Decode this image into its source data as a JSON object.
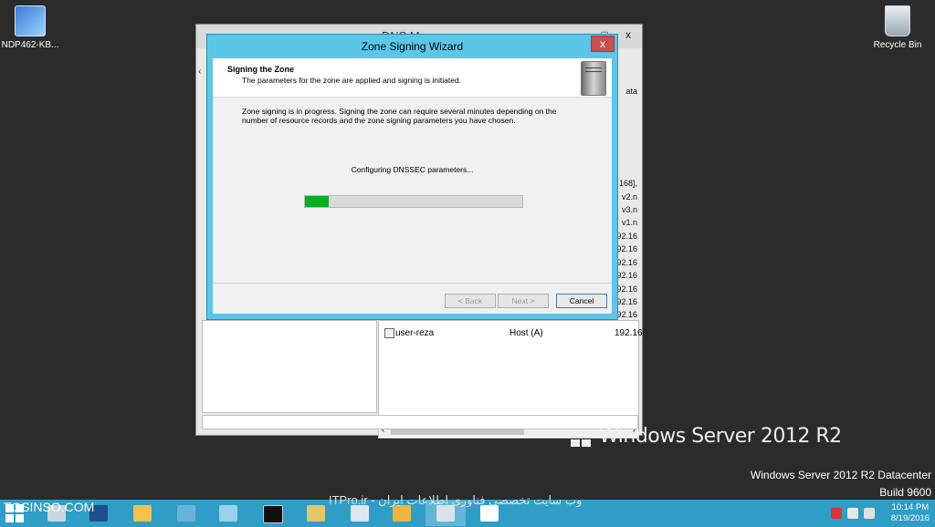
{
  "desktop": {
    "icons": [
      {
        "label": "NDP462-KB..."
      },
      {
        "label": "Recycle Bin"
      }
    ]
  },
  "dns_manager": {
    "title": "DNS Manager",
    "controls": {
      "minimize": "–",
      "maximize": "□",
      "close": "x"
    },
    "partial_column_header": "ata",
    "partial_left_glyph": "‹",
    "partial_right_values": [
      "168],",
      "v2.n",
      "v3.n",
      "v1.n",
      "92.16",
      "92.16",
      "92.16",
      "92.16",
      "92.16",
      "92.16",
      "92.16",
      "92.16"
    ],
    "row": {
      "name": "user-reza",
      "type": "Host (A)",
      "data": "192.16"
    }
  },
  "wizard": {
    "title": "Zone Signing Wizard",
    "close": "x",
    "header_title": "Signing the Zone",
    "header_subtitle": "The parameters for the zone are applied and signing is initiated.",
    "description": "Zone signing is in progress. Signing the zone can require several minutes depending on the number of resource records and the zone signing parameters you have chosen.",
    "status": "Configuring DNSSEC parameters...",
    "progress_percent": 11,
    "buttons": {
      "back": "< Back",
      "next": "Next >",
      "cancel": "Cancel"
    }
  },
  "branding": {
    "os_name": "Windows Server 2012 R2",
    "edition": "Windows Server 2012 R2 Datacenter",
    "build": "Build 9600"
  },
  "watermarks": {
    "left": "TOSINSO.COM",
    "center": "ITPro.ir - وب سایت تخصصی فناوری اطلاعات ایران"
  },
  "taskbar": {
    "apps": [
      "server-manager",
      "powershell",
      "file-explorer",
      "explorer-2",
      "control-panel",
      "cmd",
      "folder",
      "notepad",
      "wrench",
      "network",
      "vnc"
    ],
    "clock": {
      "time": "10:14 PM",
      "date": "8/19/2016"
    }
  }
}
